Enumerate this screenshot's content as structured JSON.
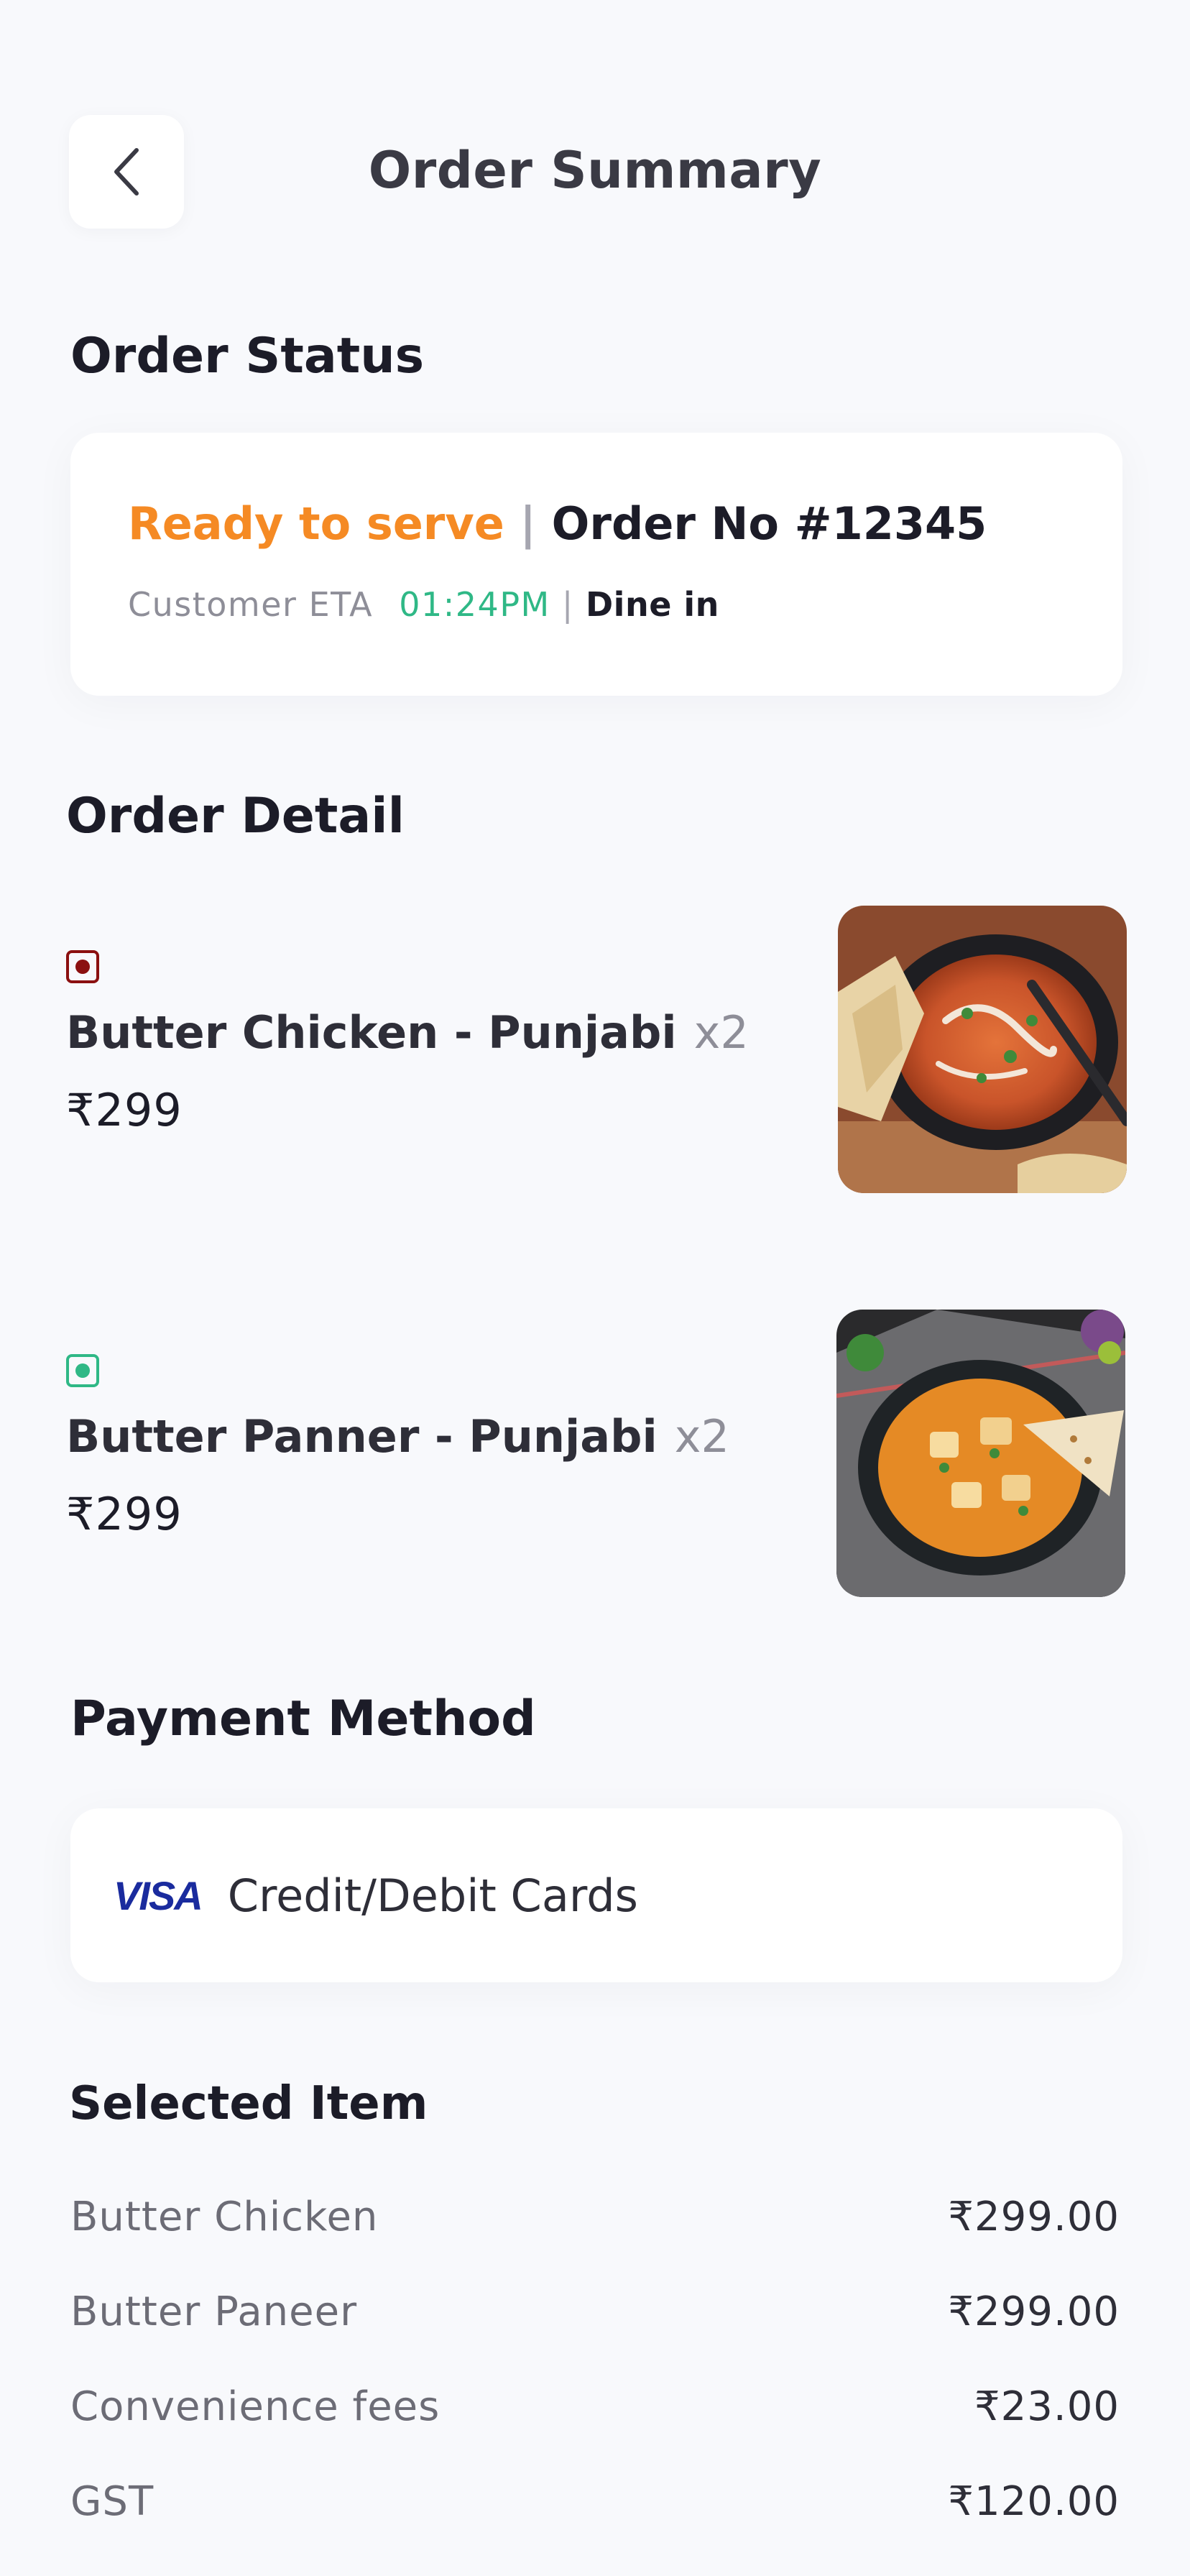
{
  "header": {
    "title": "Order Summary",
    "back_icon": "chevron-left-icon"
  },
  "order_status": {
    "section_title": "Order Status",
    "status": "Ready to serve",
    "separator": "|",
    "order_no": "Order No #12345",
    "eta_label": "Customer ETA",
    "eta_time": "01:24PM",
    "eta_separator": "|",
    "service_type": "Dine in",
    "colors": {
      "status": "#f58a24",
      "eta": "#2fb886"
    }
  },
  "order_detail": {
    "section_title": "Order Detail",
    "items": [
      {
        "name": "Butter Chicken - Punjabi",
        "qty": "x2",
        "price": "₹299",
        "diet_icon": "non-veg-mark-icon",
        "diet_color": "#8b1010",
        "image_icon": "butter-chicken-image"
      },
      {
        "name": "Butter Panner - Punjabi",
        "qty": "x2",
        "price": "₹299",
        "diet_icon": "veg-mark-icon",
        "diet_color": "#2fb886",
        "image_icon": "butter-paneer-image"
      }
    ]
  },
  "payment": {
    "section_title": "Payment Method",
    "card_brand": "VISA",
    "method_label": "Credit/Debit Cards"
  },
  "selected_items": {
    "section_title": "Selected Item",
    "rows": [
      {
        "label": "Butter Chicken",
        "value": "₹299.00"
      },
      {
        "label": "Butter Paneer",
        "value": "₹299.00"
      },
      {
        "label": "Convenience fees",
        "value": "₹23.00"
      },
      {
        "label": "GST",
        "value": "₹120.00"
      }
    ]
  }
}
